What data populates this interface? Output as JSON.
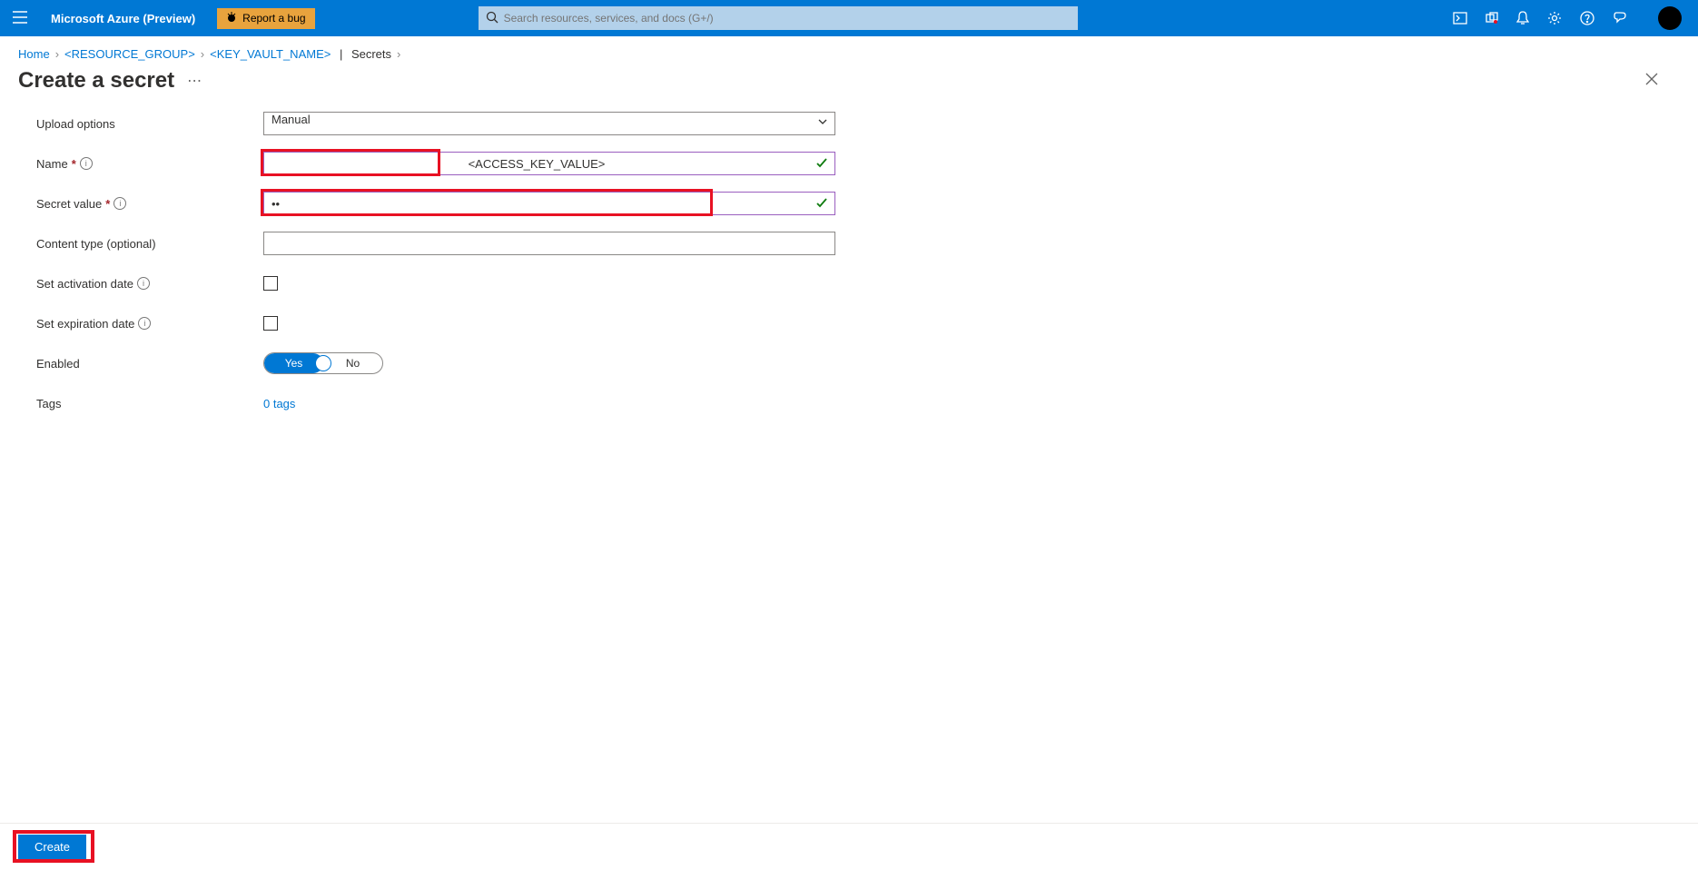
{
  "header": {
    "brand": "Microsoft Azure (Preview)",
    "report_bug": "Report a bug",
    "search_placeholder": "Search resources, services, and docs (G+/)"
  },
  "breadcrumb": {
    "home": "Home",
    "rg": "<RESOURCE_GROUP>",
    "kv": "<KEY_VAULT_NAME>",
    "secrets": "Secrets"
  },
  "page": {
    "title": "Create a secret"
  },
  "form": {
    "upload_options_label": "Upload options",
    "upload_options_value": "Manual",
    "name_label": "Name",
    "name_value": "<ACCESS_KEY_VALUE>",
    "secret_value_label": "Secret value",
    "secret_value_value": "••",
    "content_type_label": "Content type (optional)",
    "content_type_value": "",
    "activation_label": "Set activation date",
    "expiration_label": "Set expiration date",
    "enabled_label": "Enabled",
    "enabled_yes": "Yes",
    "enabled_no": "No",
    "tags_label": "Tags",
    "tags_link": "0 tags"
  },
  "footer": {
    "create": "Create"
  }
}
